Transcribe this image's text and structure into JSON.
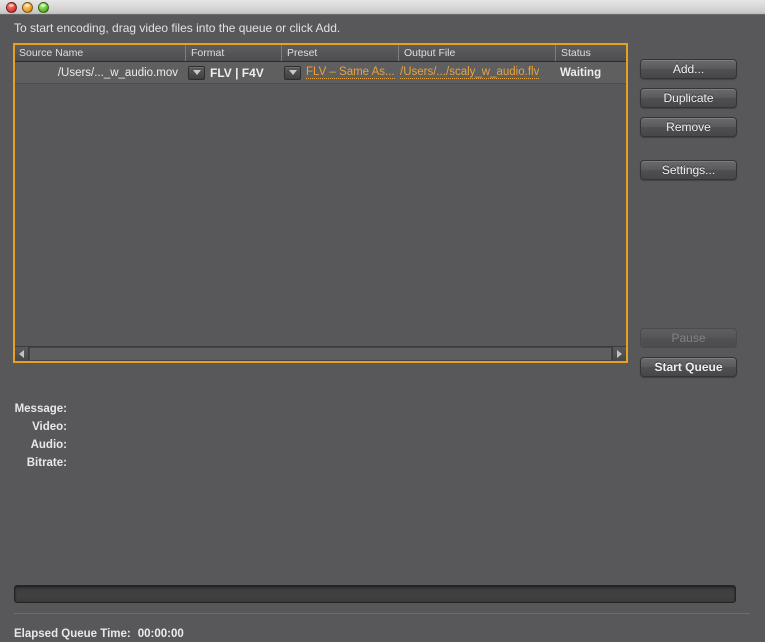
{
  "window": {
    "traffic_lights": [
      "close",
      "minimize",
      "maximize"
    ]
  },
  "hint": {
    "text": "To start encoding, drag video files into the queue or click Add."
  },
  "queue": {
    "columns": [
      {
        "key": "source",
        "label": "Source Name"
      },
      {
        "key": "format",
        "label": "Format"
      },
      {
        "key": "preset",
        "label": "Preset"
      },
      {
        "key": "output",
        "label": "Output File"
      },
      {
        "key": "status",
        "label": "Status"
      }
    ],
    "rows": [
      {
        "source": "/Users/..._w_audio.mov",
        "format": "FLV | F4V",
        "preset": "FLV – Same As...",
        "output": "/Users/.../scaly_w_audio.flv",
        "status": "Waiting"
      }
    ],
    "focus_border_color": "#e8a020",
    "link_color": "#e8a33d"
  },
  "buttons": {
    "add": "Add...",
    "duplicate": "Duplicate",
    "remove": "Remove",
    "settings": "Settings...",
    "pause": "Pause",
    "pause_enabled": false,
    "start_queue": "Start Queue",
    "start_queue_enabled": true
  },
  "info": {
    "rows": [
      {
        "label": "Message:",
        "value": ""
      },
      {
        "label": "Video:",
        "value": ""
      },
      {
        "label": "Audio:",
        "value": ""
      },
      {
        "label": "Bitrate:",
        "value": ""
      }
    ]
  },
  "progress": {
    "percent": 0
  },
  "footer": {
    "elapsed_label": "Elapsed Queue Time:",
    "elapsed_value": "00:00:00"
  }
}
